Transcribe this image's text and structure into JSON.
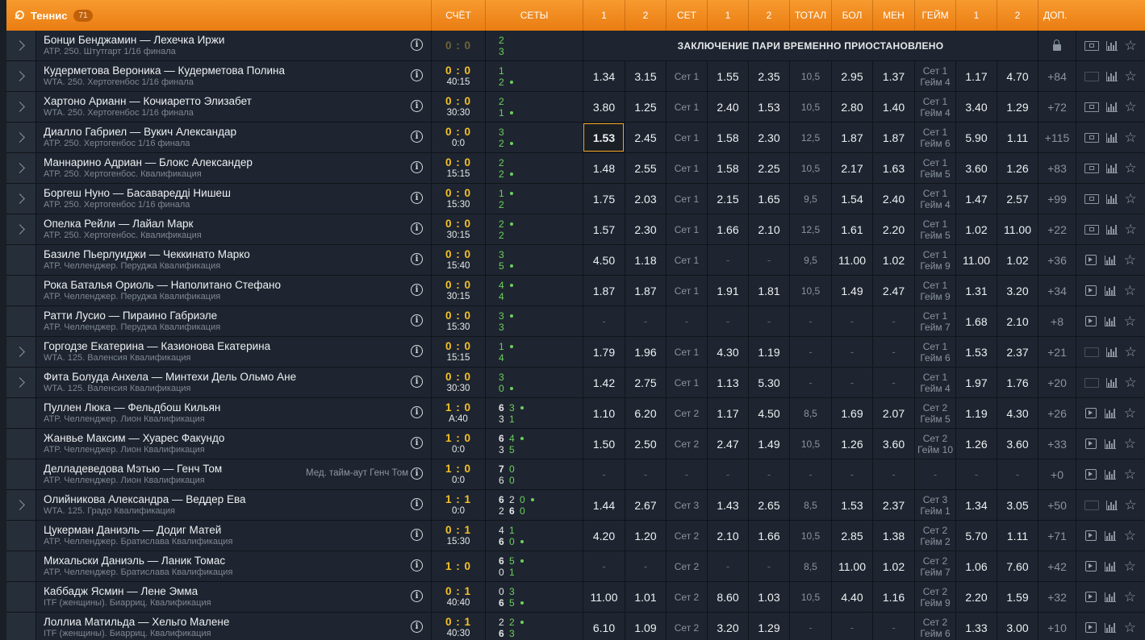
{
  "header": {
    "sport": "Теннис",
    "count": "71",
    "cols": [
      "СЧЁТ",
      "СЕТЫ",
      "1",
      "2",
      "СЕТ",
      "1",
      "2",
      "ТОТАЛ",
      "БОЛ",
      "МЕН",
      "ГЕЙМ",
      "1",
      "2",
      "ДОП."
    ]
  },
  "suspended_text": "ЗАКЛЮЧЕНИЕ ПАРИ ВРЕМЕННО ПРИОСТАНОВЛЕНО",
  "rows": [
    {
      "exp": true,
      "name": "Бонци Бенджамин — Лехечка Иржи",
      "league": "ATP. 250. Штутгарт 1/16 финала",
      "score": "0 : 0",
      "time": "",
      "s1": [
        "2"
      ],
      "s2": [
        "3"
      ],
      "srv": 0,
      "suspended": true,
      "media": "tv"
    },
    {
      "exp": true,
      "name": "Кудерметова Вероника — Кудерметова Полина",
      "league": "WTA. 250. Хертогенбос 1/16 финала",
      "score": "0 : 0",
      "time": "40:15",
      "s1": [
        "1"
      ],
      "s2": [
        "2"
      ],
      "srv": 2,
      "o": [
        "1.34",
        "3.15",
        "Сет 1",
        "1.55",
        "2.35",
        "10,5",
        "2.95",
        "1.37",
        "Сет 1|Гейм 4",
        "1.17",
        "4.70",
        "+84"
      ],
      "media": "tvg"
    },
    {
      "exp": true,
      "name": "Хартоно Арианн — Кочиаретто Элизабет",
      "league": "WTA. 250. Хертогенбос 1/16 финала",
      "score": "0 : 0",
      "time": "30:30",
      "s1": [
        "2"
      ],
      "s2": [
        "1"
      ],
      "srv": 2,
      "o": [
        "3.80",
        "1.25",
        "Сет 1",
        "2.40",
        "1.53",
        "10,5",
        "2.80",
        "1.40",
        "Сет 1|Гейм 4",
        "3.40",
        "1.29",
        "+72"
      ],
      "media": "tv"
    },
    {
      "exp": true,
      "name": "Диалло Габриел — Вукич Александар",
      "league": "ATP. 250. Хертогенбос 1/16 финала",
      "score": "0 : 0",
      "time": "0:0",
      "s1": [
        "3"
      ],
      "s2": [
        "2"
      ],
      "srv": 2,
      "o": [
        "1.53",
        "2.45",
        "Сет 1",
        "1.58",
        "2.30",
        "12,5",
        "1.87",
        "1.87",
        "Сет 1|Гейм 6",
        "5.90",
        "1.11",
        "+115"
      ],
      "sel": true,
      "media": "tv"
    },
    {
      "exp": true,
      "name": "Маннарино Адриан — Блокс Александер",
      "league": "ATP. 250. Хертогенбос. Квалификация",
      "score": "0 : 0",
      "time": "15:15",
      "s1": [
        "2"
      ],
      "s2": [
        "2"
      ],
      "srv": 2,
      "o": [
        "1.48",
        "2.55",
        "Сет 1",
        "1.58",
        "2.25",
        "10,5",
        "2.17",
        "1.63",
        "Сет 1|Гейм 5",
        "3.60",
        "1.26",
        "+83"
      ],
      "media": "tv"
    },
    {
      "exp": true,
      "name": "Боргеш Нуно — Басавареддi Нишеш",
      "league": "ATP. 250. Хертогенбос 1/16 финала",
      "score": "0 : 0",
      "time": "15:30",
      "s1": [
        "1"
      ],
      "s2": [
        "2"
      ],
      "srv": 1,
      "o": [
        "1.75",
        "2.03",
        "Сет 1",
        "2.15",
        "1.65",
        "9,5",
        "1.54",
        "2.40",
        "Сет 1|Гейм 4",
        "1.47",
        "2.57",
        "+99"
      ],
      "media": "tv"
    },
    {
      "exp": true,
      "name": "Опелка Рейли — Лайал Марк",
      "league": "ATP. 250. Хертогенбос. Квалификация",
      "score": "0 : 0",
      "time": "30:15",
      "s1": [
        "2"
      ],
      "s2": [
        "2"
      ],
      "srv": 1,
      "o": [
        "1.57",
        "2.30",
        "Сет 1",
        "1.66",
        "2.10",
        "12,5",
        "1.61",
        "2.20",
        "Сет 1|Гейм 5",
        "1.02",
        "11.00",
        "+22"
      ],
      "media": "tv"
    },
    {
      "exp": false,
      "name": "Базиле Пьерлуиджи — Чеккинато Марко",
      "league": "ATP. Челленджер. Перуджа Квалификация",
      "score": "0 : 0",
      "time": "15:40",
      "s1": [
        "3"
      ],
      "s2": [
        "5"
      ],
      "srv": 2,
      "o": [
        "4.50",
        "1.18",
        "Сет 1",
        "-",
        "-",
        "9,5",
        "11.00",
        "1.02",
        "Сет 1|Гейм 9",
        "11.00",
        "1.02",
        "+36"
      ],
      "media": "play"
    },
    {
      "exp": false,
      "name": "Рока Баталья Ориоль — Наполитано Стефано",
      "league": "ATP. Челленджер. Перуджа Квалификация",
      "score": "0 : 0",
      "time": "30:15",
      "s1": [
        "4"
      ],
      "s2": [
        "4"
      ],
      "srv": 1,
      "o": [
        "1.87",
        "1.87",
        "Сет 1",
        "1.91",
        "1.81",
        "10,5",
        "1.49",
        "2.47",
        "Сет 1|Гейм 9",
        "1.31",
        "3.20",
        "+34"
      ],
      "media": "play"
    },
    {
      "exp": false,
      "name": "Ратти Лусио — Пираино Габриэле",
      "league": "ATP. Челленджер. Перуджа Квалификация",
      "score": "0 : 0",
      "time": "15:30",
      "s1": [
        "3"
      ],
      "s2": [
        "3"
      ],
      "srv": 1,
      "o": [
        "-",
        "-",
        "-",
        "-",
        "-",
        "-",
        "-",
        "-",
        "Сет 1|Гейм 7",
        "1.68",
        "2.10",
        "+8"
      ],
      "media": "play"
    },
    {
      "exp": true,
      "name": "Горгодзе Екатерина — Казионова Екатерина",
      "league": "WTA. 125. Валенсия Квалификация",
      "score": "0 : 0",
      "time": "15:15",
      "s1": [
        "1"
      ],
      "s2": [
        "4"
      ],
      "srv": 1,
      "o": [
        "1.79",
        "1.96",
        "Сет 1",
        "4.30",
        "1.19",
        "-",
        "-",
        "-",
        "Сет 1|Гейм 6",
        "1.53",
        "2.37",
        "+21"
      ],
      "media": "tvg"
    },
    {
      "exp": true,
      "name": "Фита Болуда Анхела — Минтехи Дель Ольмо Ане",
      "league": "WTA. 125. Валенсия Квалификация",
      "score": "0 : 0",
      "time": "30:30",
      "s1": [
        "3"
      ],
      "s2": [
        "0"
      ],
      "srv": 2,
      "o": [
        "1.42",
        "2.75",
        "Сет 1",
        "1.13",
        "5.30",
        "-",
        "-",
        "-",
        "Сет 1|Гейм 4",
        "1.97",
        "1.76",
        "+20"
      ],
      "media": "tvg"
    },
    {
      "exp": false,
      "name": "Пуллен Люка — Фельдбош Кильян",
      "league": "ATP. Челленджер. Лион Квалификация",
      "score": "1 : 0",
      "time": "A:40",
      "s1": [
        "6",
        "3"
      ],
      "s2": [
        "3",
        "1"
      ],
      "srv": 1,
      "o": [
        "1.10",
        "6.20",
        "Сет 2",
        "1.17",
        "4.50",
        "8,5",
        "1.69",
        "2.07",
        "Сет 2|Гейм 5",
        "1.19",
        "4.30",
        "+26"
      ],
      "media": "play"
    },
    {
      "exp": false,
      "name": "Жанвье Максим — Хуарес Факундо",
      "league": "ATP. Челленджер. Лион Квалификация",
      "score": "1 : 0",
      "time": "0:0",
      "s1": [
        "6",
        "4"
      ],
      "s2": [
        "3",
        "5"
      ],
      "srv": 1,
      "o": [
        "1.50",
        "2.50",
        "Сет 2",
        "2.47",
        "1.49",
        "10,5",
        "1.26",
        "3.60",
        "Сет 2|Гейм 10",
        "1.26",
        "3.60",
        "+33"
      ],
      "media": "play"
    },
    {
      "exp": false,
      "name": "Делладеведова Мэтью — Генч Том",
      "league": "ATP. Челленджер. Лион Квалификация",
      "note": "Мед. тайм-аут Генч Том",
      "score": "1 : 0",
      "time": "0:0",
      "s1": [
        "7",
        "0"
      ],
      "s2": [
        "6",
        "0"
      ],
      "srv": 0,
      "o": [
        "-",
        "-",
        "-",
        "-",
        "-",
        "-",
        "-",
        "-",
        "-",
        "-",
        "-",
        "+0"
      ],
      "media": "play"
    },
    {
      "exp": true,
      "name": "Олийникова Александра — Веддер Ева",
      "league": "WTA. 125. Градо Квалификация",
      "score": "1 : 1",
      "time": "0:0",
      "s1": [
        "6",
        "2",
        "0"
      ],
      "s2": [
        "2",
        "6",
        "0"
      ],
      "srv": 1,
      "o": [
        "1.44",
        "2.67",
        "Сет 3",
        "1.43",
        "2.65",
        "8,5",
        "1.53",
        "2.37",
        "Сет 3|Гейм 1",
        "1.34",
        "3.05",
        "+50"
      ],
      "media": "tvg"
    },
    {
      "exp": false,
      "name": "Цукерман Даниэль — Додиг Матей",
      "league": "ATP. Челленджер. Братислава Квалификация",
      "score": "0 : 1",
      "time": "15:30",
      "s1": [
        "4",
        "1"
      ],
      "s2": [
        "6",
        "0"
      ],
      "srv": 2,
      "o": [
        "4.20",
        "1.20",
        "Сет 2",
        "2.10",
        "1.66",
        "10,5",
        "2.85",
        "1.38",
        "Сет 2|Гейм 2",
        "5.70",
        "1.11",
        "+71"
      ],
      "media": "play"
    },
    {
      "exp": false,
      "name": "Михальски Даниэль — Ланик Томас",
      "league": "ATP. Челленджер. Братислава Квалификация",
      "score": "1 : 0",
      "time": "",
      "s1": [
        "6",
        "5"
      ],
      "s2": [
        "0",
        "1"
      ],
      "srv": 1,
      "o": [
        "-",
        "-",
        "Сет 2",
        "-",
        "-",
        "8,5",
        "11.00",
        "1.02",
        "Сет 2|Гейм 7",
        "1.06",
        "7.60",
        "+42"
      ],
      "media": "play"
    },
    {
      "exp": false,
      "name": "Каббадж Ясмин — Лене Эмма",
      "league": "ITF (женщины). Биарриц. Квалификация",
      "score": "0 : 1",
      "time": "40:40",
      "s1": [
        "0",
        "3"
      ],
      "s2": [
        "6",
        "5"
      ],
      "srv": 2,
      "o": [
        "11.00",
        "1.01",
        "Сет 2",
        "8.60",
        "1.03",
        "10,5",
        "4.40",
        "1.16",
        "Сет 2|Гейм 9",
        "2.20",
        "1.59",
        "+32"
      ],
      "media": "play"
    },
    {
      "exp": false,
      "name": "Лоллиа Матильда — Хельго Малене",
      "league": "ITF (женщины). Биарриц. Квалификация",
      "score": "0 : 1",
      "time": "40:30",
      "s1": [
        "2",
        "2"
      ],
      "s2": [
        "6",
        "3"
      ],
      "srv": 1,
      "o": [
        "6.10",
        "1.09",
        "Сет 2",
        "3.20",
        "1.29",
        "-",
        "-",
        "-",
        "Сет 2|Гейм 6",
        "1.33",
        "3.00",
        "+10"
      ],
      "media": "play"
    }
  ]
}
